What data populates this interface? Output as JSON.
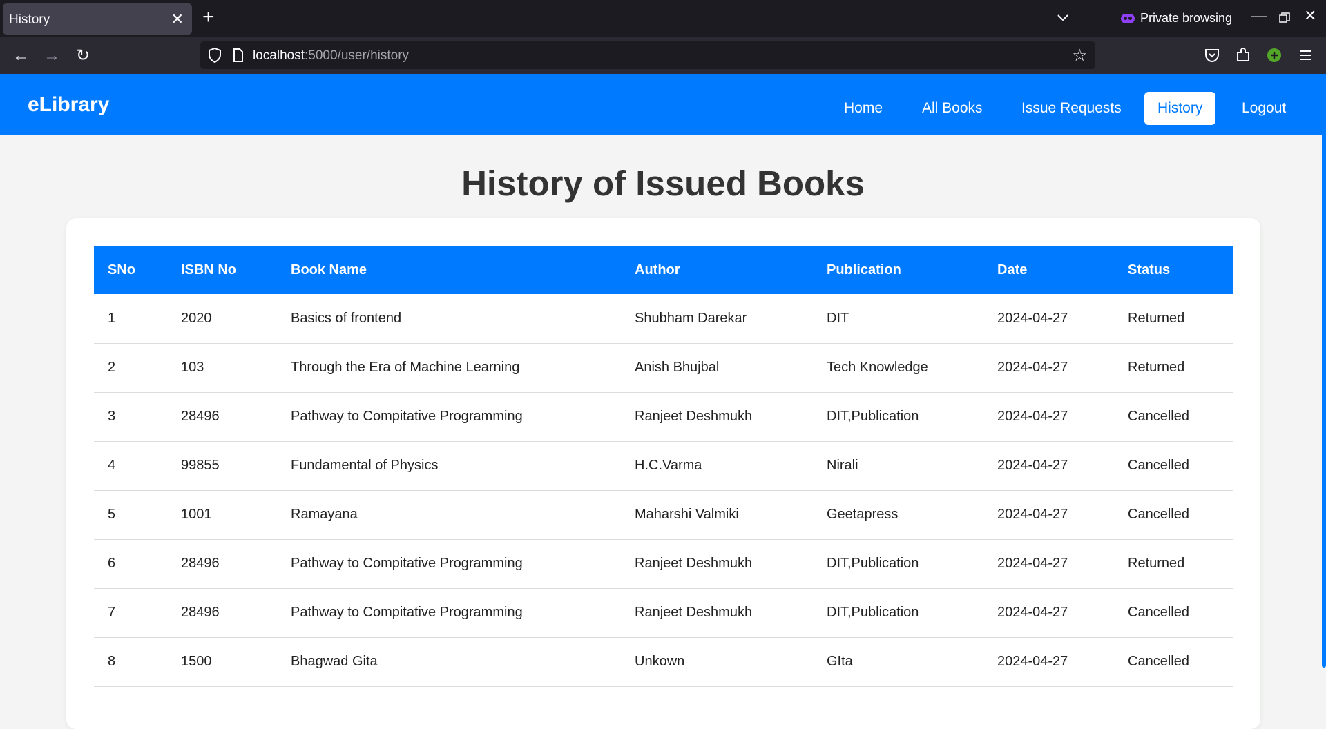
{
  "browser": {
    "tab_title": "History",
    "url_host": "localhost",
    "url_rest": ":5000/user/history",
    "private_label": "Private browsing"
  },
  "app": {
    "brand": "eLibrary",
    "nav": [
      {
        "label": "Home",
        "active": false
      },
      {
        "label": "All Books",
        "active": false
      },
      {
        "label": "Issue Requests",
        "active": false
      },
      {
        "label": "History",
        "active": true
      },
      {
        "label": "Logout",
        "active": false
      }
    ]
  },
  "page": {
    "title": "History of Issued Books"
  },
  "table": {
    "headers": [
      "SNo",
      "ISBN No",
      "Book Name",
      "Author",
      "Publication",
      "Date",
      "Status"
    ],
    "rows": [
      [
        "1",
        "2020",
        "Basics of frontend",
        "Shubham Darekar",
        "DIT",
        "2024-04-27",
        "Returned"
      ],
      [
        "2",
        "103",
        "Through the Era of Machine Learning",
        "Anish Bhujbal",
        "Tech Knowledge",
        "2024-04-27",
        "Returned"
      ],
      [
        "3",
        "28496",
        "Pathway to Compitative Programming",
        "Ranjeet Deshmukh",
        "DIT,Publication",
        "2024-04-27",
        "Cancelled"
      ],
      [
        "4",
        "99855",
        "Fundamental of Physics",
        "H.C.Varma",
        "Nirali",
        "2024-04-27",
        "Cancelled"
      ],
      [
        "5",
        "1001",
        "Ramayana",
        "Maharshi Valmiki",
        "Geetapress",
        "2024-04-27",
        "Cancelled"
      ],
      [
        "6",
        "28496",
        "Pathway to Compitative Programming",
        "Ranjeet Deshmukh",
        "DIT,Publication",
        "2024-04-27",
        "Returned"
      ],
      [
        "7",
        "28496",
        "Pathway to Compitative Programming",
        "Ranjeet Deshmukh",
        "DIT,Publication",
        "2024-04-27",
        "Cancelled"
      ],
      [
        "8",
        "1500",
        "Bhagwad Gita",
        "Unkown",
        "GIta",
        "2024-04-27",
        "Cancelled"
      ]
    ]
  },
  "colors": {
    "accent": "#007bff",
    "browser_dark": "#1c1b22"
  }
}
